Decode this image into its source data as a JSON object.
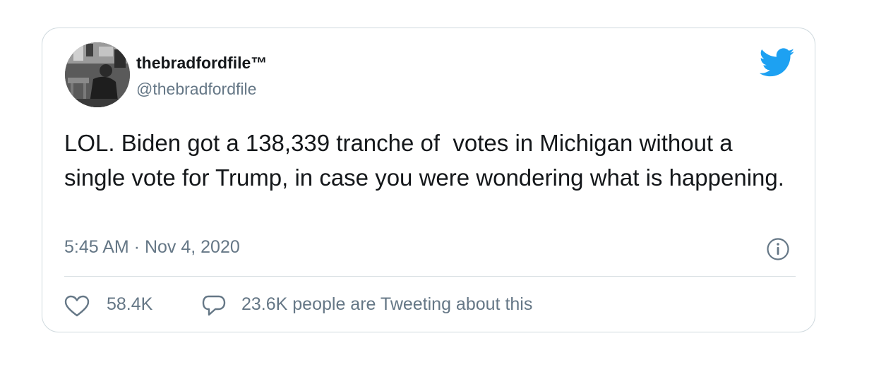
{
  "tweet": {
    "display_name": "thebradfordfile™",
    "handle": "@thebradfordfile",
    "text": "LOL. Biden got a 138,339 tranche of  votes in Michigan without a single vote for Trump, in case you were wondering what is happening.",
    "timestamp": "5:45 AM · Nov 4, 2020",
    "likes": "58.4K",
    "conversation": "23.6K people are Tweeting about this"
  },
  "icons": {
    "brand": "twitter-bird-icon",
    "info": "info-icon",
    "like": "heart-icon",
    "reply": "speech-bubble-icon"
  },
  "colors": {
    "brand": "#1da1f2",
    "text": "#14171a",
    "muted": "#657786",
    "border": "#cfd9de"
  }
}
